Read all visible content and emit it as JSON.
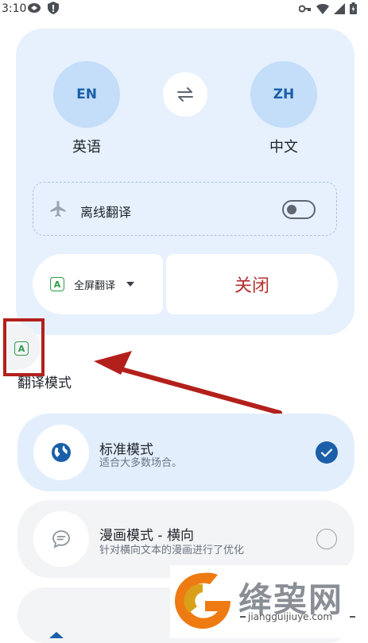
{
  "status_bar": {
    "time": "3:10"
  },
  "languages": {
    "source": {
      "code": "EN",
      "name": "英语"
    },
    "target": {
      "code": "ZH",
      "name": "中文"
    }
  },
  "offline": {
    "label": "离线翻译",
    "enabled": false
  },
  "mode_selector": {
    "label": "全屏翻译"
  },
  "close_button": {
    "label": "关闭"
  },
  "section_title": "翻译模式",
  "modes": [
    {
      "title": "标准模式",
      "desc": "适合大多数场合。",
      "selected": true
    },
    {
      "title": "漫画模式 - 横向",
      "desc": "针对横向文本的漫画进行了优化",
      "selected": false
    }
  ],
  "watermark": {
    "text": "绛巭网",
    "url": "jiangguijiuye.com"
  },
  "colors": {
    "card_bg": "#e6f1fd",
    "lang_circle": "#c4ddf9",
    "accent": "#1a5fa8",
    "close_text": "#b3302e",
    "annotation_red": "#b3201c",
    "app_green": "#2e9c4a"
  }
}
